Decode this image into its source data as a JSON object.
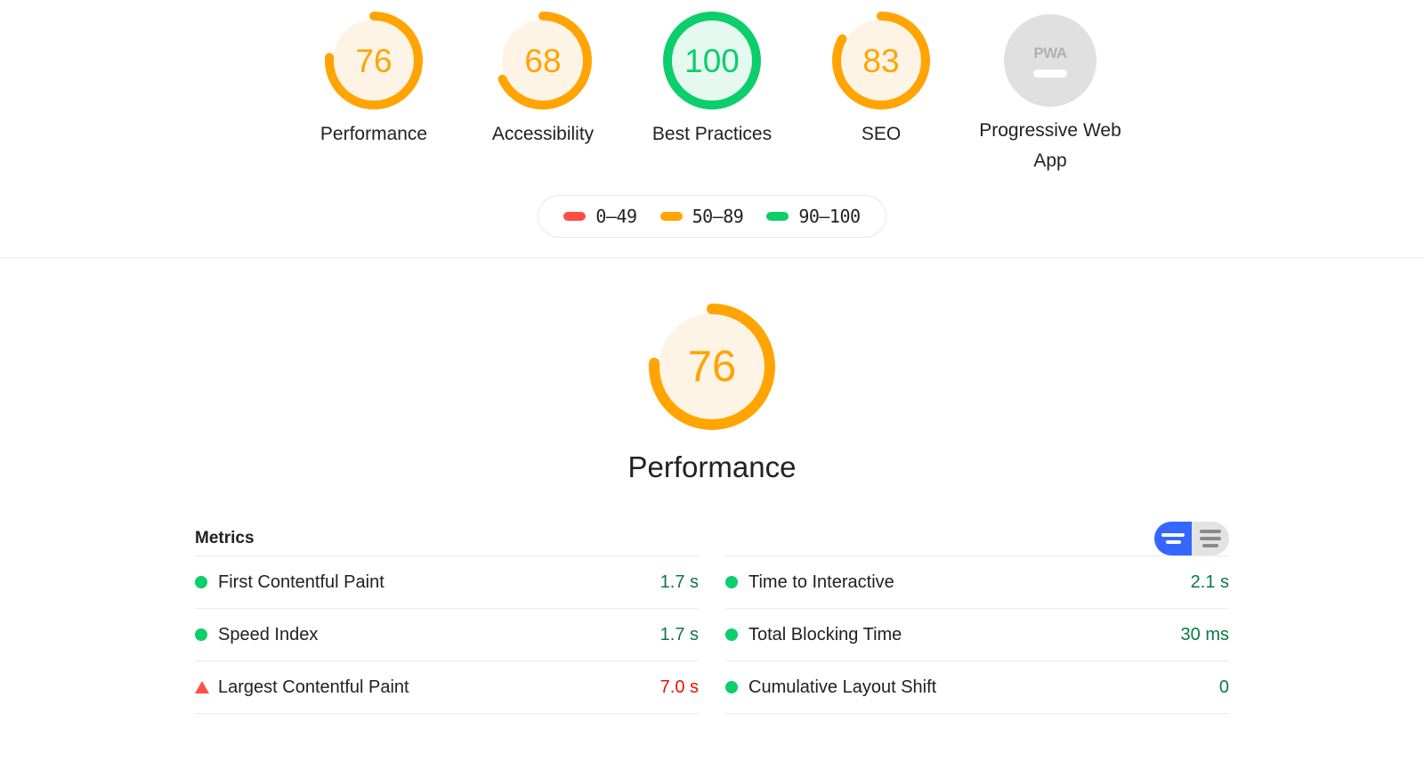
{
  "scores": {
    "gauges": [
      {
        "label": "Performance",
        "value": "76",
        "score": 76,
        "rating": "average",
        "type": "gauge"
      },
      {
        "label": "Accessibility",
        "value": "68",
        "score": 68,
        "rating": "average",
        "type": "gauge"
      },
      {
        "label": "Best Practices",
        "value": "100",
        "score": 100,
        "rating": "pass",
        "type": "gauge"
      },
      {
        "label": "SEO",
        "value": "83",
        "score": 83,
        "rating": "average",
        "type": "gauge"
      },
      {
        "label": "Progressive Web App",
        "value": "PWA",
        "score": null,
        "rating": "null",
        "type": "pwa-badge"
      }
    ]
  },
  "legend": {
    "items": [
      {
        "range": "0–49",
        "color": "#ff4e42"
      },
      {
        "range": "50–89",
        "color": "#ffa400"
      },
      {
        "range": "90–100",
        "color": "#0cce6b"
      }
    ]
  },
  "category": {
    "title": "Performance",
    "score_value": "76",
    "score": 76,
    "rating": "average"
  },
  "metrics": {
    "title": "Metrics",
    "toggle": {
      "simple_label": "simple-view",
      "expanded_label": "expanded-view",
      "active": "simple-view"
    },
    "left_column": [
      {
        "name": "First Contentful Paint",
        "value": "1.7 s",
        "rating": "pass",
        "icon": "circle"
      },
      {
        "name": "Speed Index",
        "value": "1.7 s",
        "rating": "pass",
        "icon": "circle"
      },
      {
        "name": "Largest Contentful Paint",
        "value": "7.0 s",
        "rating": "fail",
        "icon": "triangle"
      }
    ],
    "right_column": [
      {
        "name": "Time to Interactive",
        "value": "2.1 s",
        "rating": "pass",
        "icon": "circle"
      },
      {
        "name": "Total Blocking Time",
        "value": "30 ms",
        "rating": "pass",
        "icon": "circle"
      },
      {
        "name": "Cumulative Layout Shift",
        "value": "0",
        "rating": "pass",
        "icon": "circle"
      }
    ]
  },
  "colors": {
    "pass": "#0cce6b",
    "average": "#ffa400",
    "fail": "#ff4e42",
    "pass_text": "#0b7a45",
    "fail_text": "#eb0f00",
    "average_text": "#b45309",
    "null": "#e0e0e0",
    "toggle_active": "#3367ff",
    "toggle_inactive": "#e3e3e3"
  }
}
